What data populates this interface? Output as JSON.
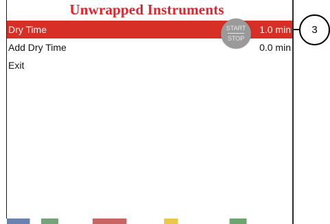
{
  "screen": {
    "title": "Unwrapped Instruments"
  },
  "menu": {
    "items": [
      {
        "label": "Dry Time",
        "value": "1.0 min",
        "selected": true
      },
      {
        "label": "Add Dry Time",
        "value": "0.0 min",
        "selected": false
      },
      {
        "label": "Exit",
        "value": "",
        "selected": false
      }
    ]
  },
  "start_stop_button": {
    "top_label": "START",
    "bottom_label": "STOP"
  },
  "callout": {
    "number": "3"
  },
  "colors": {
    "title": "#e8202a",
    "selected_row": "#d72e26",
    "button": "#9a9a9a"
  }
}
